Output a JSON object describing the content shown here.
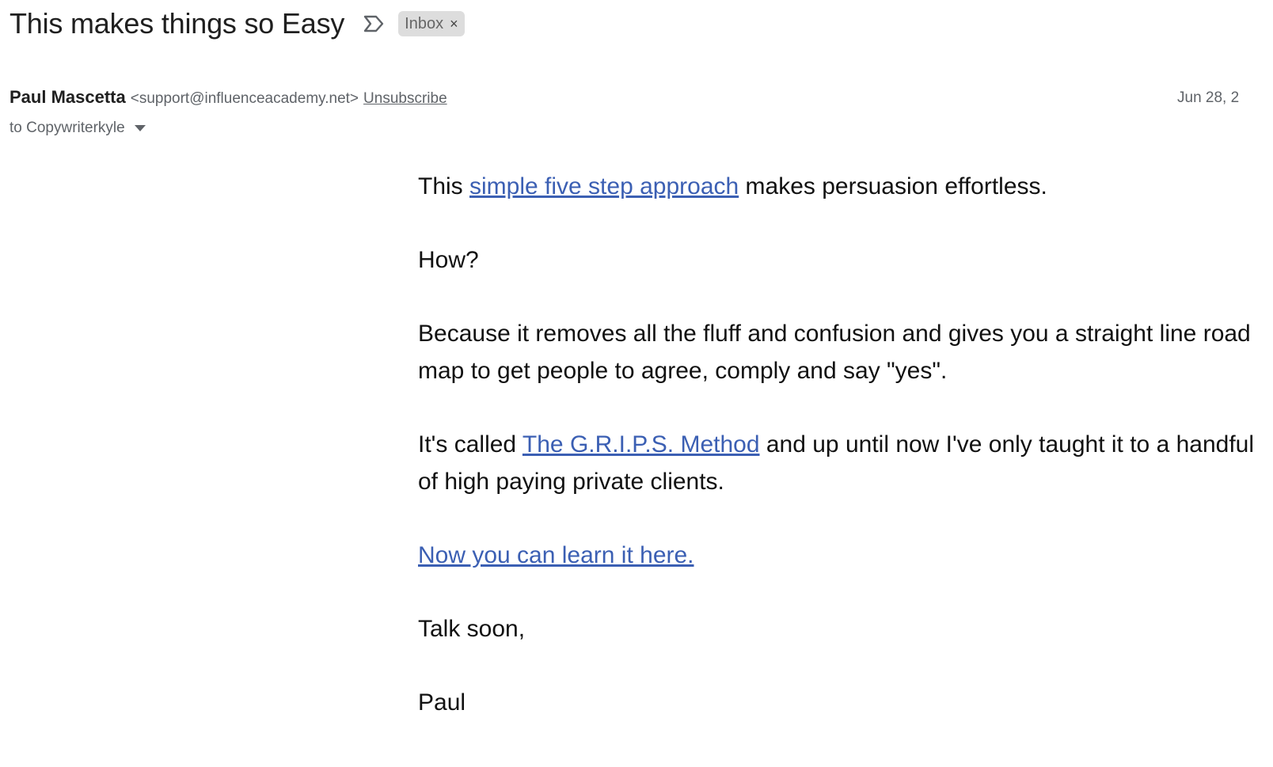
{
  "subject": {
    "title": "This makes things so Easy",
    "label_chip": "Inbox",
    "chip_close": "×"
  },
  "sender": {
    "name": "Paul Mascetta",
    "email": "<support@influenceacademy.net>",
    "unsubscribe": "Unsubscribe",
    "date": "Jun 28, 2",
    "recipient": "to Copywriterkyle"
  },
  "body": {
    "p1_before": "This ",
    "p1_link": "simple five step approach",
    "p1_after": " makes persuasion effortless.",
    "p2": "How?",
    "p3": "Because it removes all the fluff and confusion and gives you a straight line road map to get people to agree, comply and say \"yes\".",
    "p4_before": "It's called ",
    "p4_link": "The G.R.I.P.S. Method",
    "p4_after": " and up until now I've only taught it to a handful of high paying private clients.",
    "p5_link": "Now you can learn it here.",
    "p6": "Talk soon,",
    "p7": "Paul"
  },
  "icons": {
    "importance": "label-important-outline-icon",
    "dropdown": "caret-down-icon"
  },
  "colors": {
    "link": "#3b5fb3",
    "chip_bg": "#dddddd",
    "secondary_text": "#5f6368"
  }
}
